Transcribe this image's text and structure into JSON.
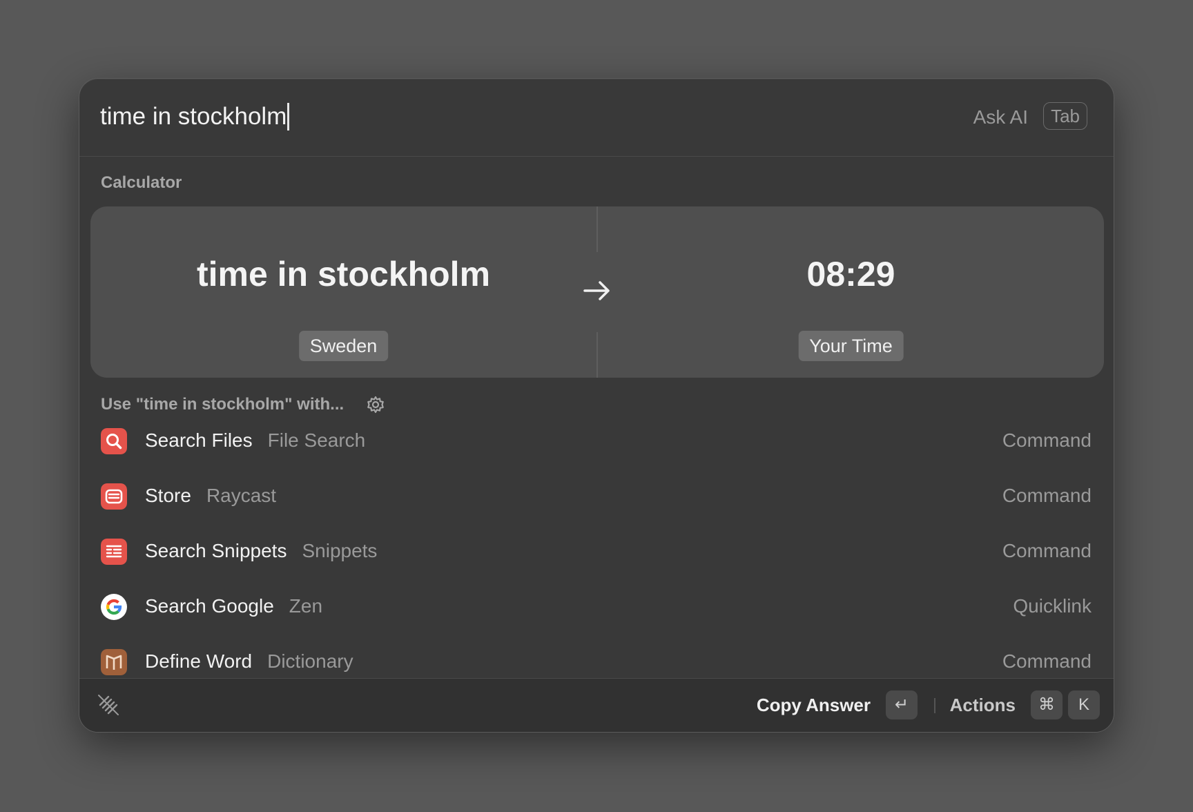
{
  "search": {
    "query": "time in stockholm",
    "ask_ai_label": "Ask AI",
    "tab_key": "Tab"
  },
  "calculator": {
    "section_title": "Calculator",
    "input": "time in stockholm",
    "input_badge": "Sweden",
    "result": "08:29",
    "result_badge": "Your Time"
  },
  "use_with": {
    "label": "Use \"time in stockholm\" with..."
  },
  "results": [
    {
      "title": "Search Files",
      "subtitle": "File Search",
      "type": "Command",
      "icon": "search-files-icon",
      "color": "#e5534b"
    },
    {
      "title": "Store",
      "subtitle": "Raycast",
      "type": "Command",
      "icon": "store-icon",
      "color": "#e5534b"
    },
    {
      "title": "Search Snippets",
      "subtitle": "Snippets",
      "type": "Command",
      "icon": "snippets-icon",
      "color": "#e5534b"
    },
    {
      "title": "Search Google",
      "subtitle": "Zen",
      "type": "Quicklink",
      "icon": "google-icon",
      "color": "#ffffff"
    },
    {
      "title": "Define Word",
      "subtitle": "Dictionary",
      "type": "Command",
      "icon": "dictionary-icon",
      "color": "#a0603a"
    }
  ],
  "footer": {
    "primary_action": "Copy Answer",
    "enter_key": "↵",
    "actions_label": "Actions",
    "cmd_key": "⌘",
    "k_key": "K"
  }
}
